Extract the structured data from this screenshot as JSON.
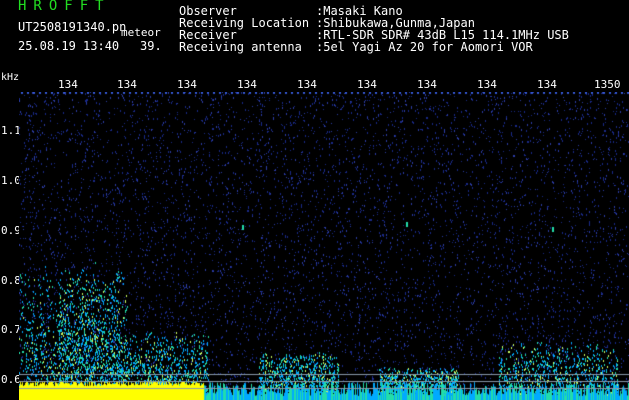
{
  "header": {
    "title": "HROFFT",
    "file": "UT2508191340.pn",
    "meteor_label": "meteor",
    "date_time": "25.08.19 13:40",
    "count": "39."
  },
  "info": [
    {
      "label": "Observer",
      "value": ":Masaki Kano"
    },
    {
      "label": "Receiving Location",
      "value": ":Shibukawa,Gunma,Japan"
    },
    {
      "label": "Receiver",
      "value": ":RTL-SDR SDR# 43dB L15 114.1MHz USB"
    },
    {
      "label": "Receiving antenna",
      "value": ":5el Yagi Az 20 for Aomori VOR"
    }
  ],
  "axis": {
    "y_unit": "kHz",
    "y_ticks": [
      "1.1",
      "1.0",
      "0.9",
      "0.8",
      "0.7",
      "0.6"
    ],
    "x_ticks": [
      "134",
      "134",
      "134",
      "134",
      "134",
      "134",
      "134",
      "134",
      "134",
      "1350"
    ]
  },
  "colors": {
    "background": "#000000",
    "noise": "#1a2a8a",
    "signal_low": "#00aaff",
    "signal_mid": "#22ddaa",
    "signal_high": "#ffff00",
    "title": "#22dd22"
  }
}
